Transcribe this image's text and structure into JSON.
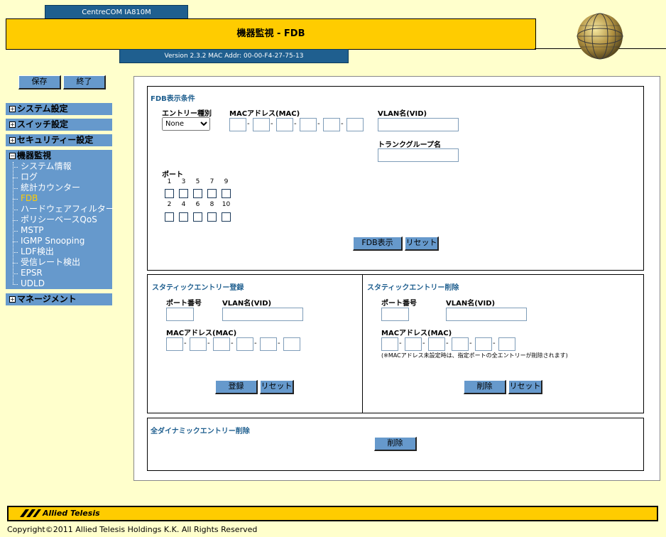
{
  "header": {
    "model": "CentreCOM IA810M",
    "title": "機器監視 - FDB",
    "version": "Version 2.3.2 MAC Addr: 00-00-F4-27-75-13"
  },
  "actions": {
    "save": "保存",
    "exit": "終了"
  },
  "sidebar": {
    "menus": {
      "system": "システム設定",
      "switch": "スイッチ設定",
      "security": "セキュリティー設定",
      "monitor": "機器監視",
      "management": "マネージメント"
    },
    "monitor_items": [
      "システム情報",
      "ログ",
      "統計カウンター",
      "FDB",
      "ハードウェアフィルター",
      "ポリシーベースQoS",
      "MSTP",
      "IGMP Snooping",
      "LDF検出",
      "受信レート検出",
      "EPSR",
      "UDLD"
    ],
    "active_item": "FDB"
  },
  "fdb_display": {
    "title": "FDB表示条件",
    "entry_type_label": "エントリー種別",
    "entry_type_value": "None",
    "mac_label": "MACアドレス(MAC)",
    "vlan_label": "VLAN名(VID)",
    "trunk_label": "トランクグループ名",
    "port_label": "ポート",
    "ports_row1": [
      "1",
      "3",
      "5",
      "7",
      "9"
    ],
    "ports_row2": [
      "2",
      "4",
      "6",
      "8",
      "10"
    ],
    "show_button": "FDB表示",
    "reset_button": "リセット"
  },
  "static_register": {
    "title": "スタティックエントリー登録",
    "port_label": "ポート番号",
    "vlan_label": "VLAN名(VID)",
    "mac_label": "MACアドレス(MAC)",
    "register_button": "登録",
    "reset_button": "リセット"
  },
  "static_delete": {
    "title": "スタティックエントリー削除",
    "port_label": "ポート番号",
    "vlan_label": "VLAN名(VID)",
    "mac_label": "MACアドレス(MAC)",
    "note": "(※MACアドレス未設定時は、指定ポートの全エントリーが削除されます)",
    "delete_button": "削除",
    "reset_button": "リセット"
  },
  "dynamic_delete": {
    "title": "全ダイナミックエントリー削除",
    "delete_button": "削除"
  },
  "footer": {
    "logo": "Allied Telesis",
    "copyright": "Copyright©2011 Allied Telesis Holdings K.K. All Rights Reserved"
  }
}
